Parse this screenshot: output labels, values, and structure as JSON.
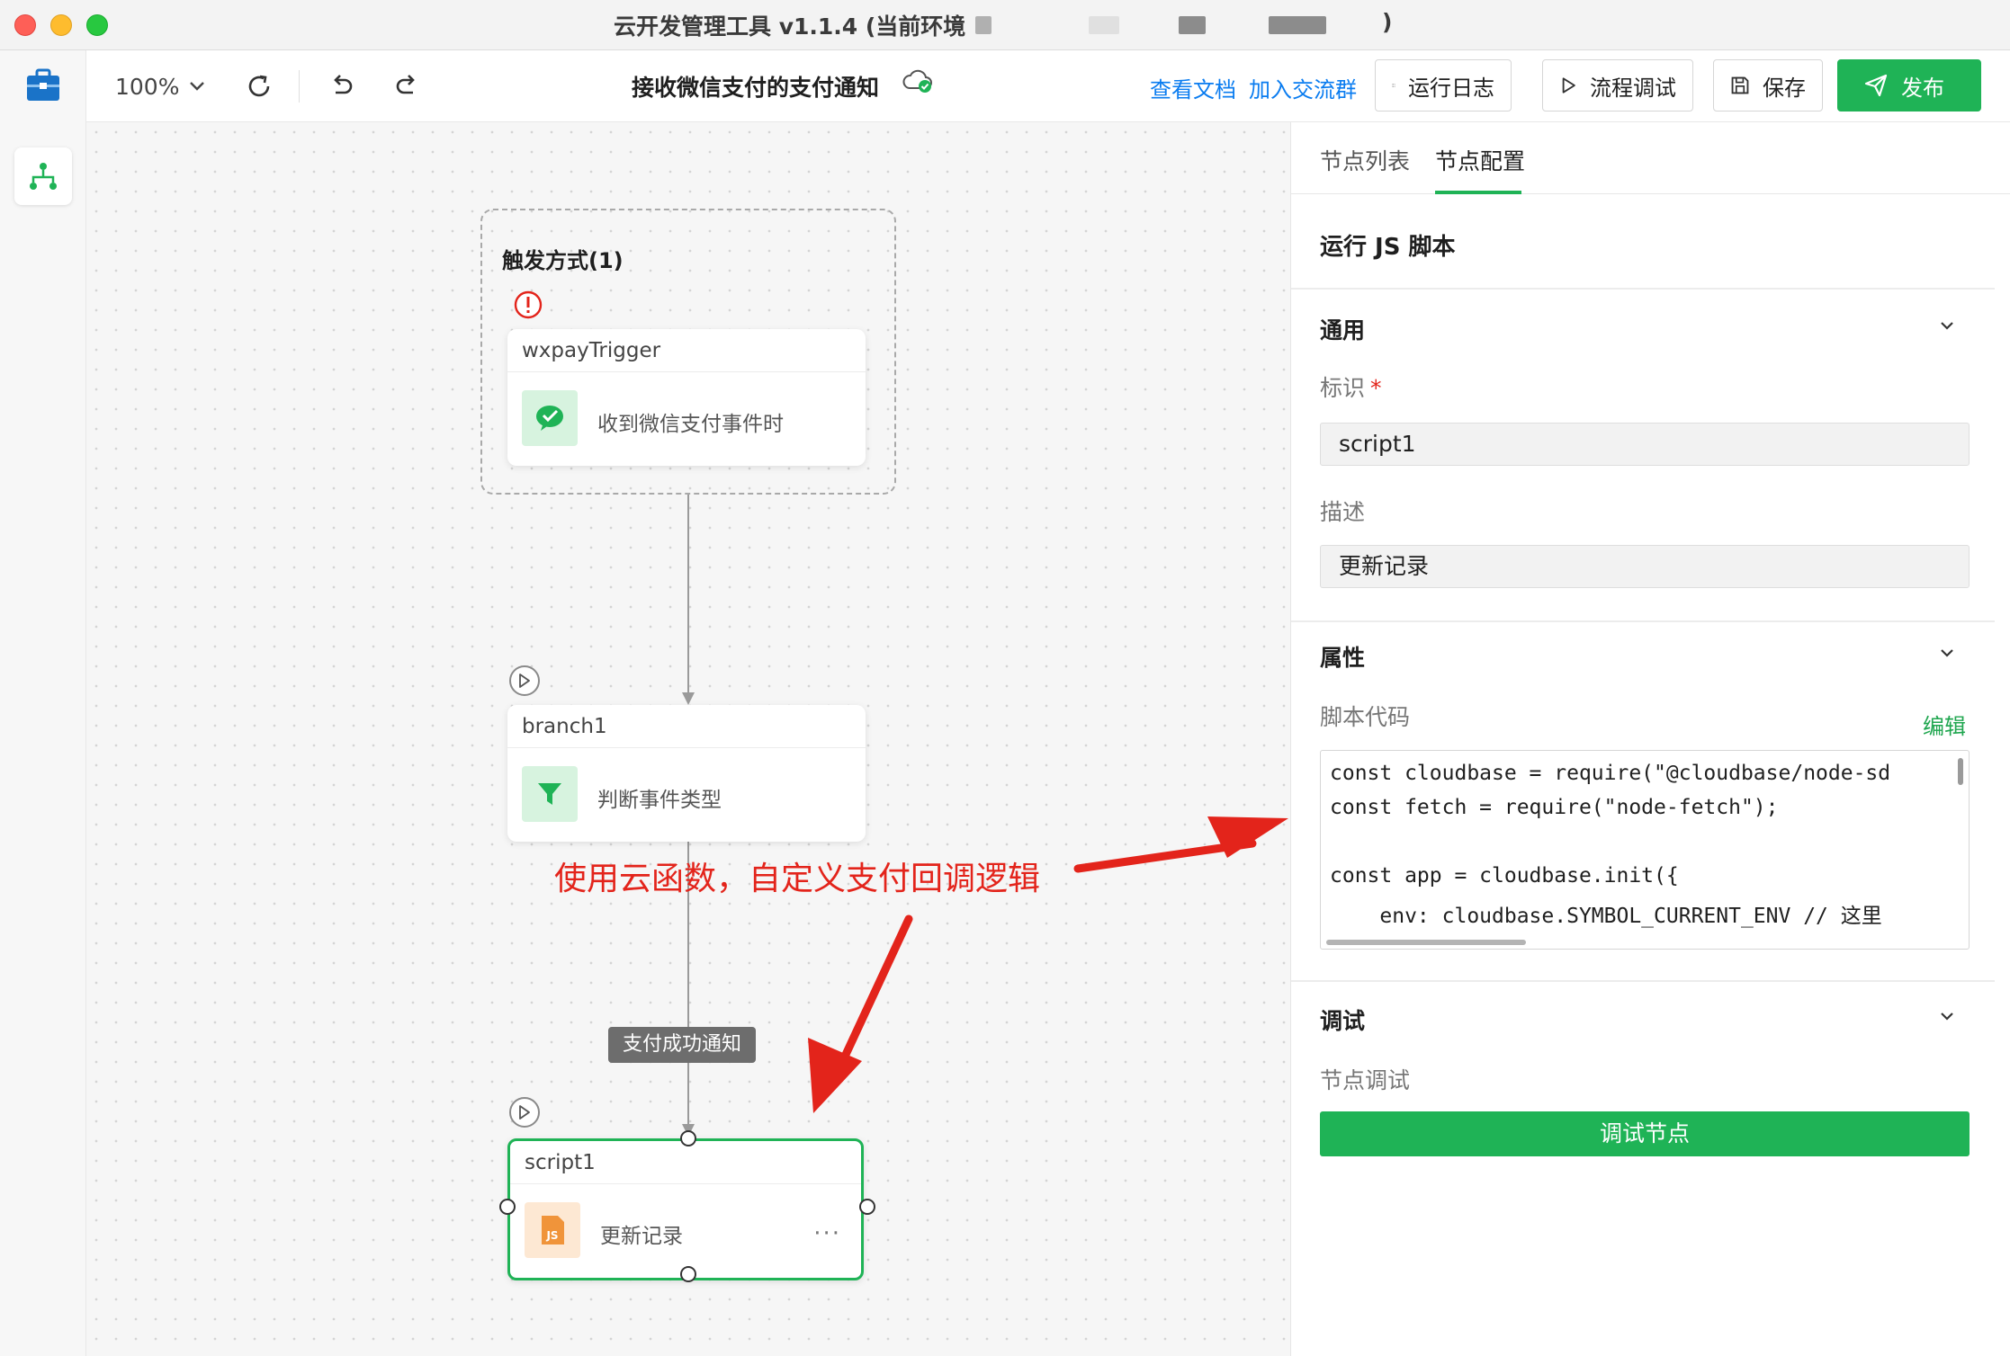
{
  "window": {
    "title": "云开发管理工具 v1.1.4 (当前环境",
    "title_tail": ")"
  },
  "toolbar": {
    "zoom": "100%",
    "flow_title": "接收微信支付的支付通知",
    "link_docs": "查看文档",
    "link_group": "加入交流群",
    "btn_logs": "运行日志",
    "btn_debug": "流程调试",
    "btn_save": "保存",
    "btn_publish": "发布"
  },
  "canvas": {
    "trigger_group_title": "触发方式(1)",
    "nodes": [
      {
        "id": "wxpayTrigger",
        "desc": "收到微信支付事件时"
      },
      {
        "id": "branch1",
        "desc": "判断事件类型"
      },
      {
        "id": "script1",
        "desc": "更新记录"
      }
    ],
    "edge_label": "支付成功通知",
    "more": "···",
    "annotation": "使用云函数，自定义支付回调逻辑"
  },
  "panel": {
    "tabs": [
      "节点列表",
      "节点配置"
    ],
    "active_tab": 1,
    "heading": "运行 JS 脚本",
    "section_general": "通用",
    "label_id": "标识",
    "required_mark": "*",
    "value_id": "script1",
    "label_desc": "描述",
    "value_desc": "更新记录",
    "section_props": "属性",
    "label_code": "脚本代码",
    "edit": "编辑",
    "code_lines": [
      "const cloudbase = require(\"@cloudbase/node-sd",
      "const fetch = require(\"node-fetch\");",
      "",
      "const app = cloudbase.init({",
      "    env: cloudbase.SYMBOL_CURRENT_ENV // 这里"
    ],
    "section_debug": "调试",
    "label_node_debug": "节点调试",
    "btn_node_debug": "调试节点"
  },
  "colors": {
    "accent": "#1fb356",
    "link": "#0a7cf0",
    "annotation": "#e3241b"
  }
}
